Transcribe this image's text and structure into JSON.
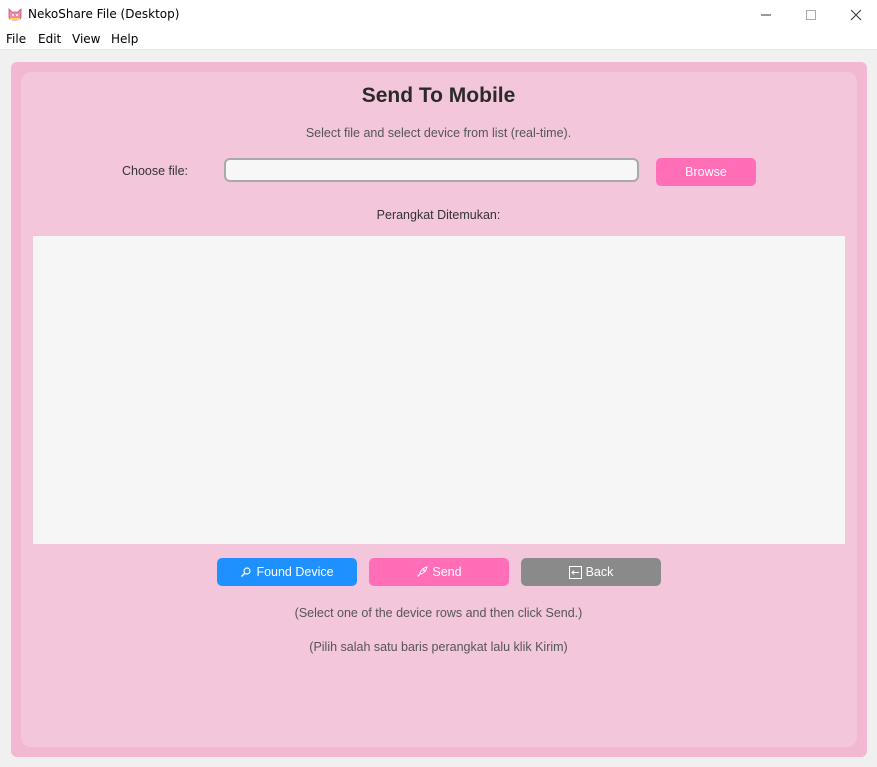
{
  "window": {
    "title": "NekoShare File (Desktop)",
    "icon": "neko-cat-icon",
    "controls": {
      "minimize": "—",
      "maximize": "☐",
      "close": "✕"
    }
  },
  "menu": {
    "items": [
      {
        "label": "File"
      },
      {
        "label": "Edit"
      },
      {
        "label": "View"
      },
      {
        "label": "Help"
      }
    ]
  },
  "main": {
    "heading": "Send To Mobile",
    "subtitle": "Select file and select device from list (real-time).",
    "choose_file_label": "Choose file:",
    "file_input_value": "",
    "browse_label": "Browse",
    "devices_label": "Perangkat Ditemukan:",
    "devices": []
  },
  "actions": {
    "found_device": {
      "label": "Found Device",
      "icon": "magnifier-icon"
    },
    "send": {
      "label": "Send",
      "icon": "rocket-icon"
    },
    "back": {
      "label": "Back",
      "icon": "back-arrow-icon"
    }
  },
  "hints": {
    "en": "(Select one of the device rows and then click Send.)",
    "id": "(Pilih salah satu baris perangkat lalu klik Kirim)"
  },
  "colors": {
    "outer_frame": "#f2b8d3",
    "inner_frame": "#f3c6dc",
    "pink_button": "#ff6eb7",
    "blue_button": "#1e90ff",
    "gray_button": "#8a8a8a"
  }
}
